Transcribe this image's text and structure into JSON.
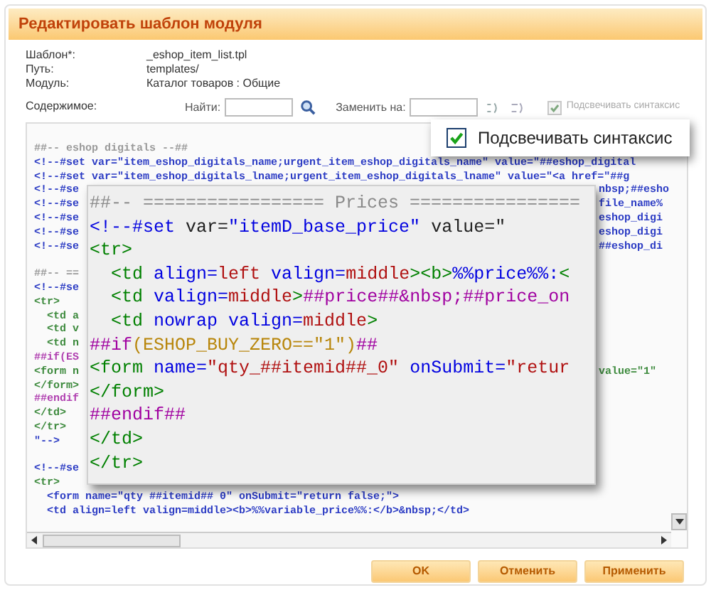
{
  "dialog": {
    "title": "Редактировать шаблон модуля"
  },
  "fields": [
    {
      "label": "Шаблон*:",
      "value": "_eshop_item_list.tpl"
    },
    {
      "label": "Путь:",
      "value": "templates/"
    },
    {
      "label": "Модуль:",
      "value": "Каталог товаров : Общие"
    }
  ],
  "content_label": "Содержимое:",
  "find": {
    "label": "Найти:"
  },
  "replace": {
    "label": "Заменить на:"
  },
  "highlight": {
    "label": "Подсвечивать синтаксис",
    "checked": true,
    "disabled": true
  },
  "editor_lines": [
    {
      "kind": "comment",
      "text": "##-- eshop digitals --##"
    },
    {
      "kind": "code",
      "text": "<!--#set var=\"item_eshop_digitals_name;urgent_item_eshop_digitals_name\" value=\"##eshop_digital"
    },
    {
      "kind": "code",
      "text": "<!--#set var=\"item_eshop_digitals_lname;urgent_item_eshop_digitals_lname\" value=\"<a href=\"##g"
    },
    {
      "kind": "code",
      "text": "<!--#se",
      "right": "nbsp;##esho"
    },
    {
      "kind": "code",
      "text": "<!--#se",
      "right": "file_name%"
    },
    {
      "kind": "code",
      "text": "<!--#se",
      "right": "eshop_digi"
    },
    {
      "kind": "code",
      "text": "<!--#se",
      "right": "eshop_digi"
    },
    {
      "kind": "code",
      "text": "<!--#se",
      "right": "##eshop_di"
    },
    {
      "kind": "blank"
    },
    {
      "kind": "comment",
      "text": "##-- =="
    },
    {
      "kind": "code",
      "text": "<!--#se"
    },
    {
      "kind": "tag",
      "text": "<tr>"
    },
    {
      "kind": "tag",
      "text": "  <td a"
    },
    {
      "kind": "tag",
      "text": "  <td v"
    },
    {
      "kind": "tag",
      "text": "  <td n"
    },
    {
      "kind": "directive",
      "text": "##if(ES"
    },
    {
      "kind": "tag",
      "text": "<form n",
      "right": "value=\"1\""
    },
    {
      "kind": "tag",
      "text": "</form>"
    },
    {
      "kind": "directive",
      "text": "##endif"
    },
    {
      "kind": "tag",
      "text": "</td>"
    },
    {
      "kind": "tag",
      "text": "</tr>"
    },
    {
      "kind": "code",
      "text": "\"-->"
    },
    {
      "kind": "blank"
    },
    {
      "kind": "code",
      "text": "<!--#se"
    },
    {
      "kind": "tag",
      "text": "<tr>"
    },
    {
      "kind": "code",
      "text": "  <form name=\"qty ##itemid## 0\" onSubmit=\"return false;\">"
    },
    {
      "kind": "code",
      "text": "  <td align=left valign=middle><b>%%variable_price%%:</b>&nbsp;</td>"
    }
  ],
  "magnifier": {
    "lines": [
      {
        "segments": [
          {
            "kind": "comment",
            "text": "##-- ================= Prices ================"
          }
        ]
      },
      {
        "segments": [
          {
            "kind": "name",
            "text": "<!--#set"
          },
          {
            "kind": "plain",
            "text": " var="
          },
          {
            "kind": "name",
            "text": "\"itemD_base_price\""
          },
          {
            "kind": "plain",
            "text": " value=\""
          }
        ]
      },
      {
        "segments": [
          {
            "kind": "tag",
            "text": "<tr>"
          }
        ]
      },
      {
        "segments": [
          {
            "kind": "tag",
            "text": "  <td"
          },
          {
            "kind": "name",
            "text": " align="
          },
          {
            "kind": "value",
            "text": "left"
          },
          {
            "kind": "name",
            "text": " valign="
          },
          {
            "kind": "value",
            "text": "middle"
          },
          {
            "kind": "tag",
            "text": "><b>"
          },
          {
            "kind": "name",
            "text": "%%price%%:"
          },
          {
            "kind": "tag",
            "text": "<"
          }
        ]
      },
      {
        "segments": [
          {
            "kind": "tag",
            "text": "  <td"
          },
          {
            "kind": "name",
            "text": " valign="
          },
          {
            "kind": "value",
            "text": "middle"
          },
          {
            "kind": "tag",
            "text": ">"
          },
          {
            "kind": "directive",
            "text": "##price##&nbsp;##price_on"
          }
        ]
      },
      {
        "segments": [
          {
            "kind": "tag",
            "text": "  <td"
          },
          {
            "kind": "name",
            "text": " nowrap valign="
          },
          {
            "kind": "value",
            "text": "middle"
          },
          {
            "kind": "tag",
            "text": ">"
          }
        ]
      },
      {
        "segments": [
          {
            "kind": "directive",
            "text": "##if"
          },
          {
            "kind": "expr",
            "text": "(ESHOP_BUY_ZERO==\"1\")"
          },
          {
            "kind": "directive",
            "text": "##"
          }
        ]
      },
      {
        "segments": [
          {
            "kind": "tag",
            "text": "<form"
          },
          {
            "kind": "name",
            "text": " name="
          },
          {
            "kind": "value",
            "text": "\"qty_##itemid##_0\""
          },
          {
            "kind": "name",
            "text": " onSubmit="
          },
          {
            "kind": "value",
            "text": "\"retur"
          }
        ]
      },
      {
        "segments": [
          {
            "kind": "tag",
            "text": "</form>"
          }
        ]
      },
      {
        "segments": [
          {
            "kind": "directive",
            "text": "##endif##"
          }
        ]
      },
      {
        "segments": [
          {
            "kind": "tag",
            "text": "</td>"
          }
        ]
      },
      {
        "segments": [
          {
            "kind": "tag",
            "text": "</tr>"
          }
        ]
      }
    ]
  },
  "magnified_option": {
    "label": "Подсвечивать синтаксис",
    "checked": true
  },
  "buttons": [
    "OK",
    "Отменить",
    "Применить"
  ]
}
